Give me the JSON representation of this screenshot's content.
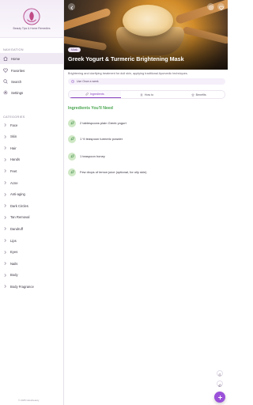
{
  "brand": {
    "name": "Beauty Tips & Home Remedies"
  },
  "navigation": {
    "title": "NAVIGATION",
    "items": [
      {
        "label": "Home",
        "icon": "home-icon"
      },
      {
        "label": "Favorites",
        "icon": "heart-icon"
      },
      {
        "label": "Search",
        "icon": "search-icon"
      },
      {
        "label": "Settings",
        "icon": "gear-icon"
      }
    ]
  },
  "categories": {
    "title": "CATEGORIES",
    "items": [
      {
        "label": "Face"
      },
      {
        "label": "Skin"
      },
      {
        "label": "Hair"
      },
      {
        "label": "Hands"
      },
      {
        "label": "Feet"
      },
      {
        "label": "Acne"
      },
      {
        "label": "Anti-aging"
      },
      {
        "label": "Dark Circles"
      },
      {
        "label": "Tan Removal"
      },
      {
        "label": "Dandruff"
      },
      {
        "label": "Lips"
      },
      {
        "label": "Eyes"
      },
      {
        "label": "Nails"
      },
      {
        "label": "Body"
      },
      {
        "label": "Body Fragrance"
      }
    ]
  },
  "footer": {
    "copyright": "© 2025 Glowbeauty"
  },
  "recipe": {
    "tag": "Mask",
    "title": "Greek Yogurt & Turmeric Brightening Mask",
    "description": "Brightening and clarifying treatment for dull skin, applying traditional Ayurvedic techniques.",
    "usage": "Use Once a week"
  },
  "tabs": [
    {
      "label": "Ingredients",
      "icon": "leaf-icon",
      "active": true
    },
    {
      "label": "How to",
      "icon": "list-icon",
      "active": false
    },
    {
      "label": "Benefits",
      "icon": "star-icon",
      "active": false
    }
  ],
  "ingredients": {
    "title": "Ingredients You'll Need",
    "items": [
      "2 tablespoons plain Greek yogurt",
      "1 ½ teaspoon turmeric powder",
      "1 teaspoon honey",
      "Few drops of lemon juice (optional, for oily skin)"
    ]
  },
  "colors": {
    "accent": "#9b51d9",
    "green": "#4aa650",
    "sidebar_active": "#efe9f3"
  }
}
